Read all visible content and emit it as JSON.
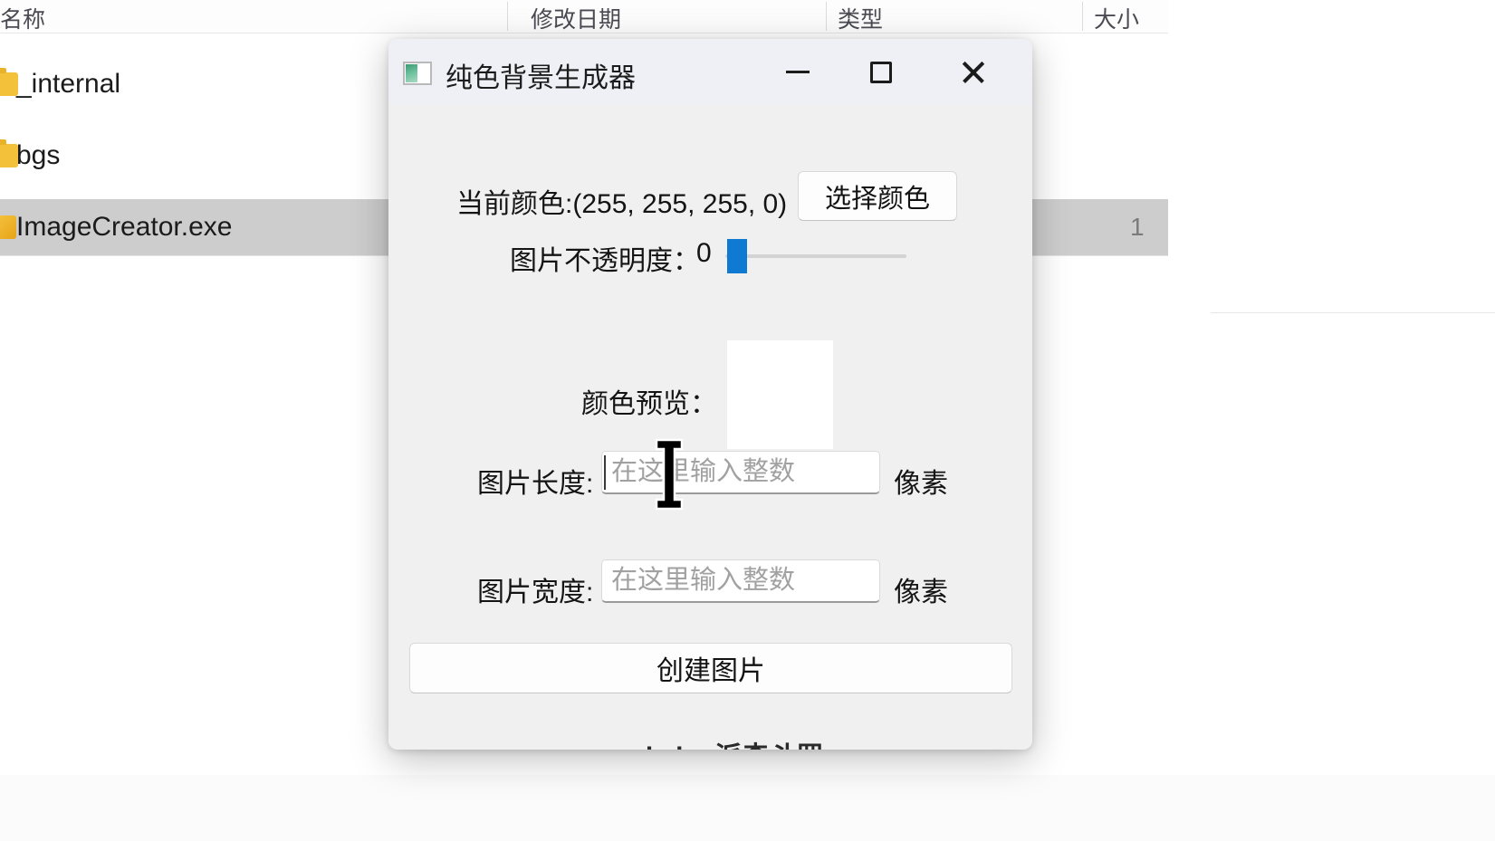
{
  "explorer": {
    "columns": [
      "名称",
      "修改日期",
      "类型",
      "大小"
    ],
    "rows": [
      {
        "icon": "folder-icon",
        "name": "_internal",
        "size": ""
      },
      {
        "icon": "folder-icon",
        "name": "bgs",
        "size": ""
      },
      {
        "icon": "exe-icon",
        "name": "ImageCreator.exe",
        "size": "1"
      }
    ]
  },
  "dialog": {
    "title": "纯色背景生成器",
    "icon": "app-window-icon",
    "window_controls": {
      "minimize": "minimize-icon",
      "maximize": "maximize-icon",
      "close": "close-icon"
    },
    "current_color": {
      "label": "当前颜色:(255, 255, 255, 0)",
      "rgba": "(255, 255, 255, 0)",
      "choose_button": "选择颜色"
    },
    "opacity": {
      "label": "图片不透明度：",
      "value": "0",
      "min": 0,
      "max": 255,
      "accent": "#0f7ad1"
    },
    "preview": {
      "label": "颜色预览：",
      "swatch_color": "#ffffff"
    },
    "length_field": {
      "label": "图片长度:",
      "value": "",
      "placeholder": "在这里输入整数",
      "unit": "像素"
    },
    "width_field": {
      "label": "图片宽度:",
      "value": "",
      "placeholder": "在这里输入整数",
      "unit": "像素"
    },
    "create_button": "创建图片",
    "credit": "made by 派森斗罗"
  }
}
